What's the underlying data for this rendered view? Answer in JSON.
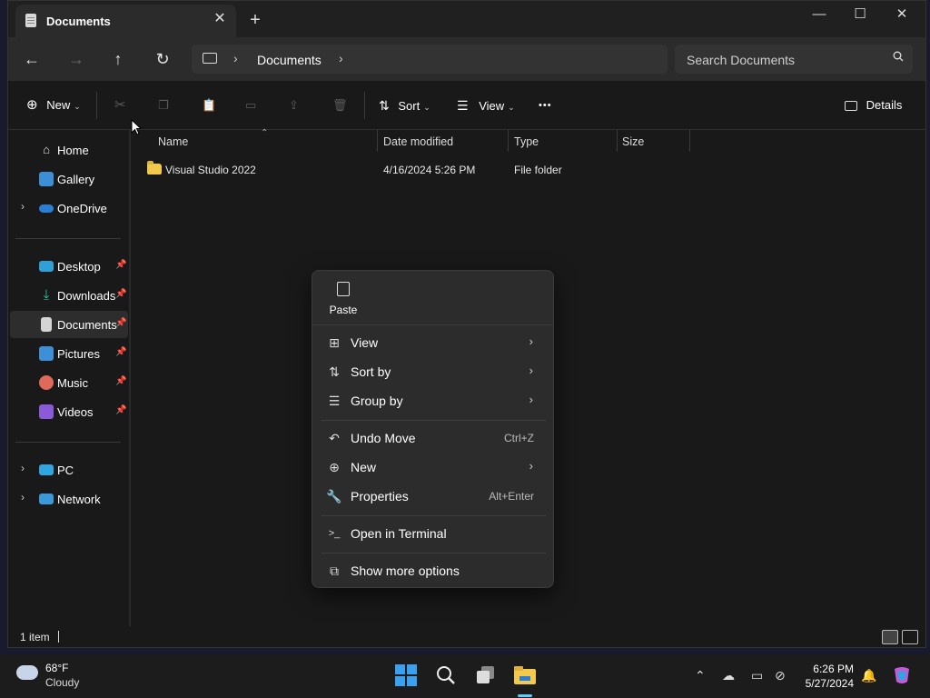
{
  "window": {
    "tab_title": "Documents",
    "tab_close": "✕",
    "new_tab": "+",
    "minimize": "—",
    "maximize": "☐",
    "close": "✕"
  },
  "nav": {
    "back": "←",
    "forward": "→",
    "up": "↑",
    "refresh": "↻",
    "breadcrumb": "Documents",
    "search_placeholder": "Search Documents"
  },
  "toolbar": {
    "new_label": "New",
    "sort_label": "Sort",
    "view_label": "View",
    "more": "•••",
    "details_label": "Details"
  },
  "sidebar": {
    "items": [
      {
        "label": "Home"
      },
      {
        "label": "Gallery"
      },
      {
        "label": "OneDrive"
      },
      {
        "label": "Desktop"
      },
      {
        "label": "Downloads"
      },
      {
        "label": "Documents"
      },
      {
        "label": "Pictures"
      },
      {
        "label": "Music"
      },
      {
        "label": "Videos"
      },
      {
        "label": "PC"
      },
      {
        "label": "Network"
      }
    ]
  },
  "columns": {
    "name": "Name",
    "date": "Date modified",
    "type": "Type",
    "size": "Size"
  },
  "files": [
    {
      "name": "Visual Studio 2022",
      "date": "4/16/2024 5:26 PM",
      "type": "File folder",
      "size": ""
    }
  ],
  "status": {
    "count": "1 item"
  },
  "context_menu": {
    "paste": "Paste",
    "items": [
      {
        "label": "View"
      },
      {
        "label": "Sort by"
      },
      {
        "label": "Group by"
      },
      {
        "label": "Undo Move",
        "shortcut": "Ctrl+Z"
      },
      {
        "label": "New"
      },
      {
        "label": "Properties",
        "shortcut": "Alt+Enter"
      },
      {
        "label": "Open in Terminal"
      },
      {
        "label": "Show more options"
      }
    ]
  },
  "taskbar": {
    "temperature": "68°F",
    "condition": "Cloudy",
    "time": "6:26 PM",
    "date": "5/27/2024"
  },
  "colors": {
    "accent": "#60cdff",
    "window_bg": "#191919",
    "menu_bg": "#2c2c2c",
    "folder": "#f2c94c"
  }
}
